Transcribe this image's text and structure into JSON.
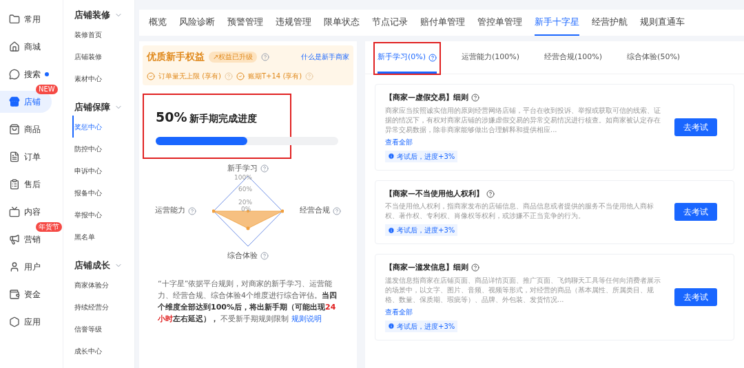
{
  "nav": [
    {
      "label": "常用",
      "selected": false
    },
    {
      "label": "商城",
      "selected": false
    },
    {
      "label": "搜索",
      "selected": false,
      "dot": true
    },
    {
      "label": "店铺",
      "selected": true,
      "badge": "NEW"
    },
    {
      "label": "商品",
      "selected": false
    },
    {
      "label": "订单",
      "selected": false
    },
    {
      "label": "售后",
      "selected": false
    },
    {
      "label": "内容",
      "selected": false
    },
    {
      "label": "营销",
      "selected": false,
      "badge": "年货节"
    },
    {
      "label": "用户",
      "selected": false
    },
    {
      "label": "资金",
      "selected": false
    },
    {
      "label": "应用",
      "selected": false
    }
  ],
  "subnav": [
    {
      "title": "店铺装修",
      "expanded": true,
      "items": [
        {
          "label": "装修首页",
          "selected": false
        },
        {
          "label": "店铺装修",
          "selected": false
        },
        {
          "label": "素材中心",
          "selected": false
        }
      ]
    },
    {
      "title": "店铺保障",
      "expanded": true,
      "items": [
        {
          "label": "奖惩中心",
          "selected": true
        },
        {
          "label": "防控中心",
          "selected": false
        },
        {
          "label": "申诉中心",
          "selected": false
        },
        {
          "label": "报备中心",
          "selected": false
        },
        {
          "label": "举报中心",
          "selected": false
        },
        {
          "label": "黑名单",
          "selected": false
        }
      ]
    },
    {
      "title": "店铺成长",
      "expanded": true,
      "items": [
        {
          "label": "商家体验分",
          "selected": false
        },
        {
          "label": "持续经营分",
          "selected": false
        },
        {
          "label": "信誉等级",
          "selected": false
        },
        {
          "label": "成长中心",
          "selected": false
        }
      ]
    }
  ],
  "top_tabs": [
    {
      "label": "概览",
      "selected": false
    },
    {
      "label": "风险诊断",
      "selected": false
    },
    {
      "label": "预警管理",
      "selected": false
    },
    {
      "label": "违规管理",
      "selected": false
    },
    {
      "label": "限单状态",
      "selected": false
    },
    {
      "label": "节点记录",
      "selected": false
    },
    {
      "label": "赔付单管理",
      "selected": false
    },
    {
      "label": "管控单管理",
      "selected": false
    },
    {
      "label": "新手十字星",
      "selected": true
    },
    {
      "label": "经营护航",
      "selected": false
    },
    {
      "label": "规则直通车",
      "selected": false
    }
  ],
  "benefits": {
    "title": "优质新手权益",
    "tag": "↗权益已升级",
    "link": "什么是新手商家",
    "items": [
      "订单量无上限 (享有)",
      "账期T+14 (享有)"
    ]
  },
  "progress": {
    "percent": "50%",
    "label": "新手期完成进度",
    "level": 0.5,
    "highlighted": true
  },
  "radar": {
    "top": "新手学习",
    "left": "运营能力",
    "right": "经营合规",
    "bottom": "综合体验",
    "ticks": [
      "100%",
      "60%",
      "20%",
      "0%"
    ]
  },
  "description": {
    "parts": [
      {
        "kind": "normal",
        "text": "“十字星”依据平台规则，对商家的新手学习、运营能力、经营合规、综合体验4个维度进行综合评估。"
      },
      {
        "kind": "bold",
        "text": "当四个维度全部达到100%后，将出新手期（可能出现"
      },
      {
        "kind": "alert",
        "text": "24小时"
      },
      {
        "kind": "bold",
        "text": "左右延迟），"
      },
      {
        "kind": "normal",
        "text": " 不受新手期规则限制 "
      }
    ],
    "link": "规则说明"
  },
  "tabs": [
    {
      "label": "新手学习(0%)",
      "selected": true,
      "help": true,
      "highlighted": true
    },
    {
      "label": "运营能力(100%)",
      "selected": false,
      "help": false,
      "highlighted": false
    },
    {
      "label": "经营合规(100%)",
      "selected": false,
      "help": false,
      "highlighted": false
    },
    {
      "label": "综合体验(50%)",
      "selected": false,
      "help": false,
      "highlighted": false
    }
  ],
  "cards": [
    {
      "title": "【商家—虚假交易】细则",
      "body": "商家应当按照诚实信用的原则经营网络店铺，平台在收到投诉、举报或获取可信的线索、证据的情况下，有权对商家店铺的涉嫌虚假交易的异常交易情况进行核查。如商家被认定存在异常交易数据，除非商家能够做出合理解释和提供相应...",
      "more": "查看全部",
      "note": "考试后，进度+3%",
      "button": "去考试"
    },
    {
      "title": "【商家—不当使用他人权利】",
      "body": "不当使用他人权利，指商家发布的店铺信息、商品信息或者提供的服务不当使用他人商标权、著作权、专利权、肖像权等权利，或涉嫌不正当竞争的行为。",
      "note": "考试后，进度+3%",
      "button": "去考试"
    },
    {
      "title": "【商家—滥发信息】细则",
      "body": "滥发信息指商家在店铺页面、商品详情页面、推广页面、飞鸽聊天工具等任何向消费者展示的场景中，以文字、图片、音频、视频等形式，对经营的商品（基本属性、所属类目、规格、数量、保质期、瑕疵等）、品牌、外包装、发货情况...",
      "more": "查看全部",
      "note": "考试后，进度+3%",
      "button": "去考试"
    }
  ]
}
